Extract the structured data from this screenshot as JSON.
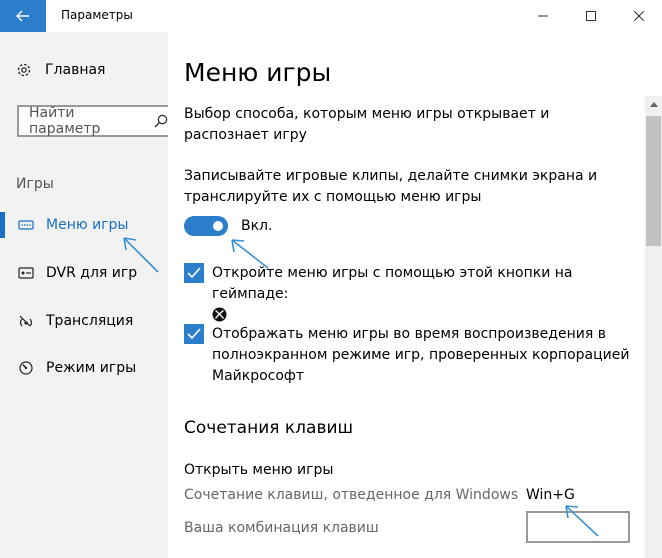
{
  "window": {
    "title": "Параметры"
  },
  "sidebar": {
    "home_label": "Главная",
    "search_placeholder": "Найти параметр",
    "section_label": "Игры",
    "items": [
      {
        "label": "Меню игры",
        "icon": "game-bar-icon",
        "active": true
      },
      {
        "label": "DVR для игр",
        "icon": "dvr-icon",
        "active": false
      },
      {
        "label": "Трансляция",
        "icon": "broadcast-icon",
        "active": false
      },
      {
        "label": "Режим игры",
        "icon": "game-mode-icon",
        "active": false
      }
    ]
  },
  "main": {
    "title": "Меню игры",
    "description": "Выбор способа, которым меню игры открывает и распознает игру",
    "record_text": "Записывайте игровые клипы, делайте снимки экрана и транслируйте их с помощью меню игры",
    "toggle_label": "Вкл.",
    "checkbox1": "Откройте меню игры с помощью этой кнопки на геймпаде:",
    "checkbox2": "Отображать меню игры во время воспроизведения в полноэкранном режиме игр, проверенных корпорацией Майкрософт",
    "shortcuts_title": "Сочетания клавиш",
    "open_menu_label": "Открыть меню игры",
    "default_shortcut_label": "Сочетание клавиш, отведенное для Windows",
    "default_shortcut_value": "Win+G",
    "custom_shortcut_label": "Ваша комбинация клавиш"
  },
  "colors": {
    "accent": "#2b7ec9",
    "arrow": "#3a8fd0"
  }
}
